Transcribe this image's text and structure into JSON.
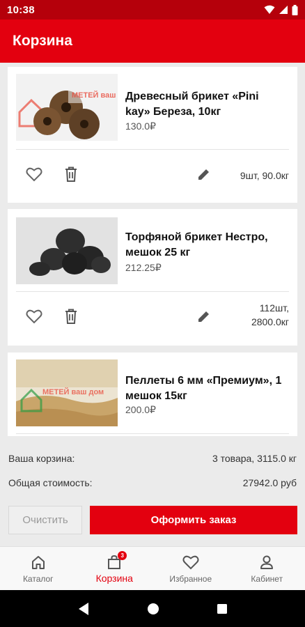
{
  "status_bar": {
    "time": "10:38"
  },
  "app_bar": {
    "title": "Корзина"
  },
  "cart": {
    "items": [
      {
        "name": "Древесный брикет «Pini kay» Береза, 10кг",
        "price": "130.0₽",
        "quantity_line1": "9шт, 90.0кг",
        "quantity_line2": "",
        "image": "wood-briquette-image"
      },
      {
        "name": "Торфяной брикет Нестро, мешок 25 кг",
        "price": "212.25₽",
        "quantity_line1": "112шт,",
        "quantity_line2": "2800.0кг",
        "image": "peat-briquette-image"
      },
      {
        "name": "Пеллеты 6 мм  «Премиум», 1 мешок 15кг",
        "price": "200.0₽",
        "quantity_line1": "",
        "quantity_line2": "",
        "image": "pellets-image"
      }
    ]
  },
  "summary": {
    "cart_label": "Ваша корзина:",
    "cart_value": "3 товара, 3115.0 кг",
    "total_label": "Общая стоимость:",
    "total_value": "27942.0 руб"
  },
  "actions": {
    "clear_label": "Очистить",
    "order_label": "Оформить заказ"
  },
  "bottom_nav": {
    "items": [
      {
        "label": "Каталог",
        "icon": "home-icon"
      },
      {
        "label": "Корзина",
        "icon": "bag-icon",
        "badge": "3",
        "active": true
      },
      {
        "label": "Избранное",
        "icon": "heart-icon"
      },
      {
        "label": "Кабинет",
        "icon": "person-icon"
      }
    ]
  },
  "watermark_text": "МЕТЕЙ ваш дом",
  "colors": {
    "primary": "#e3000f",
    "status_bar": "#b5000b",
    "background": "#ebebeb"
  }
}
